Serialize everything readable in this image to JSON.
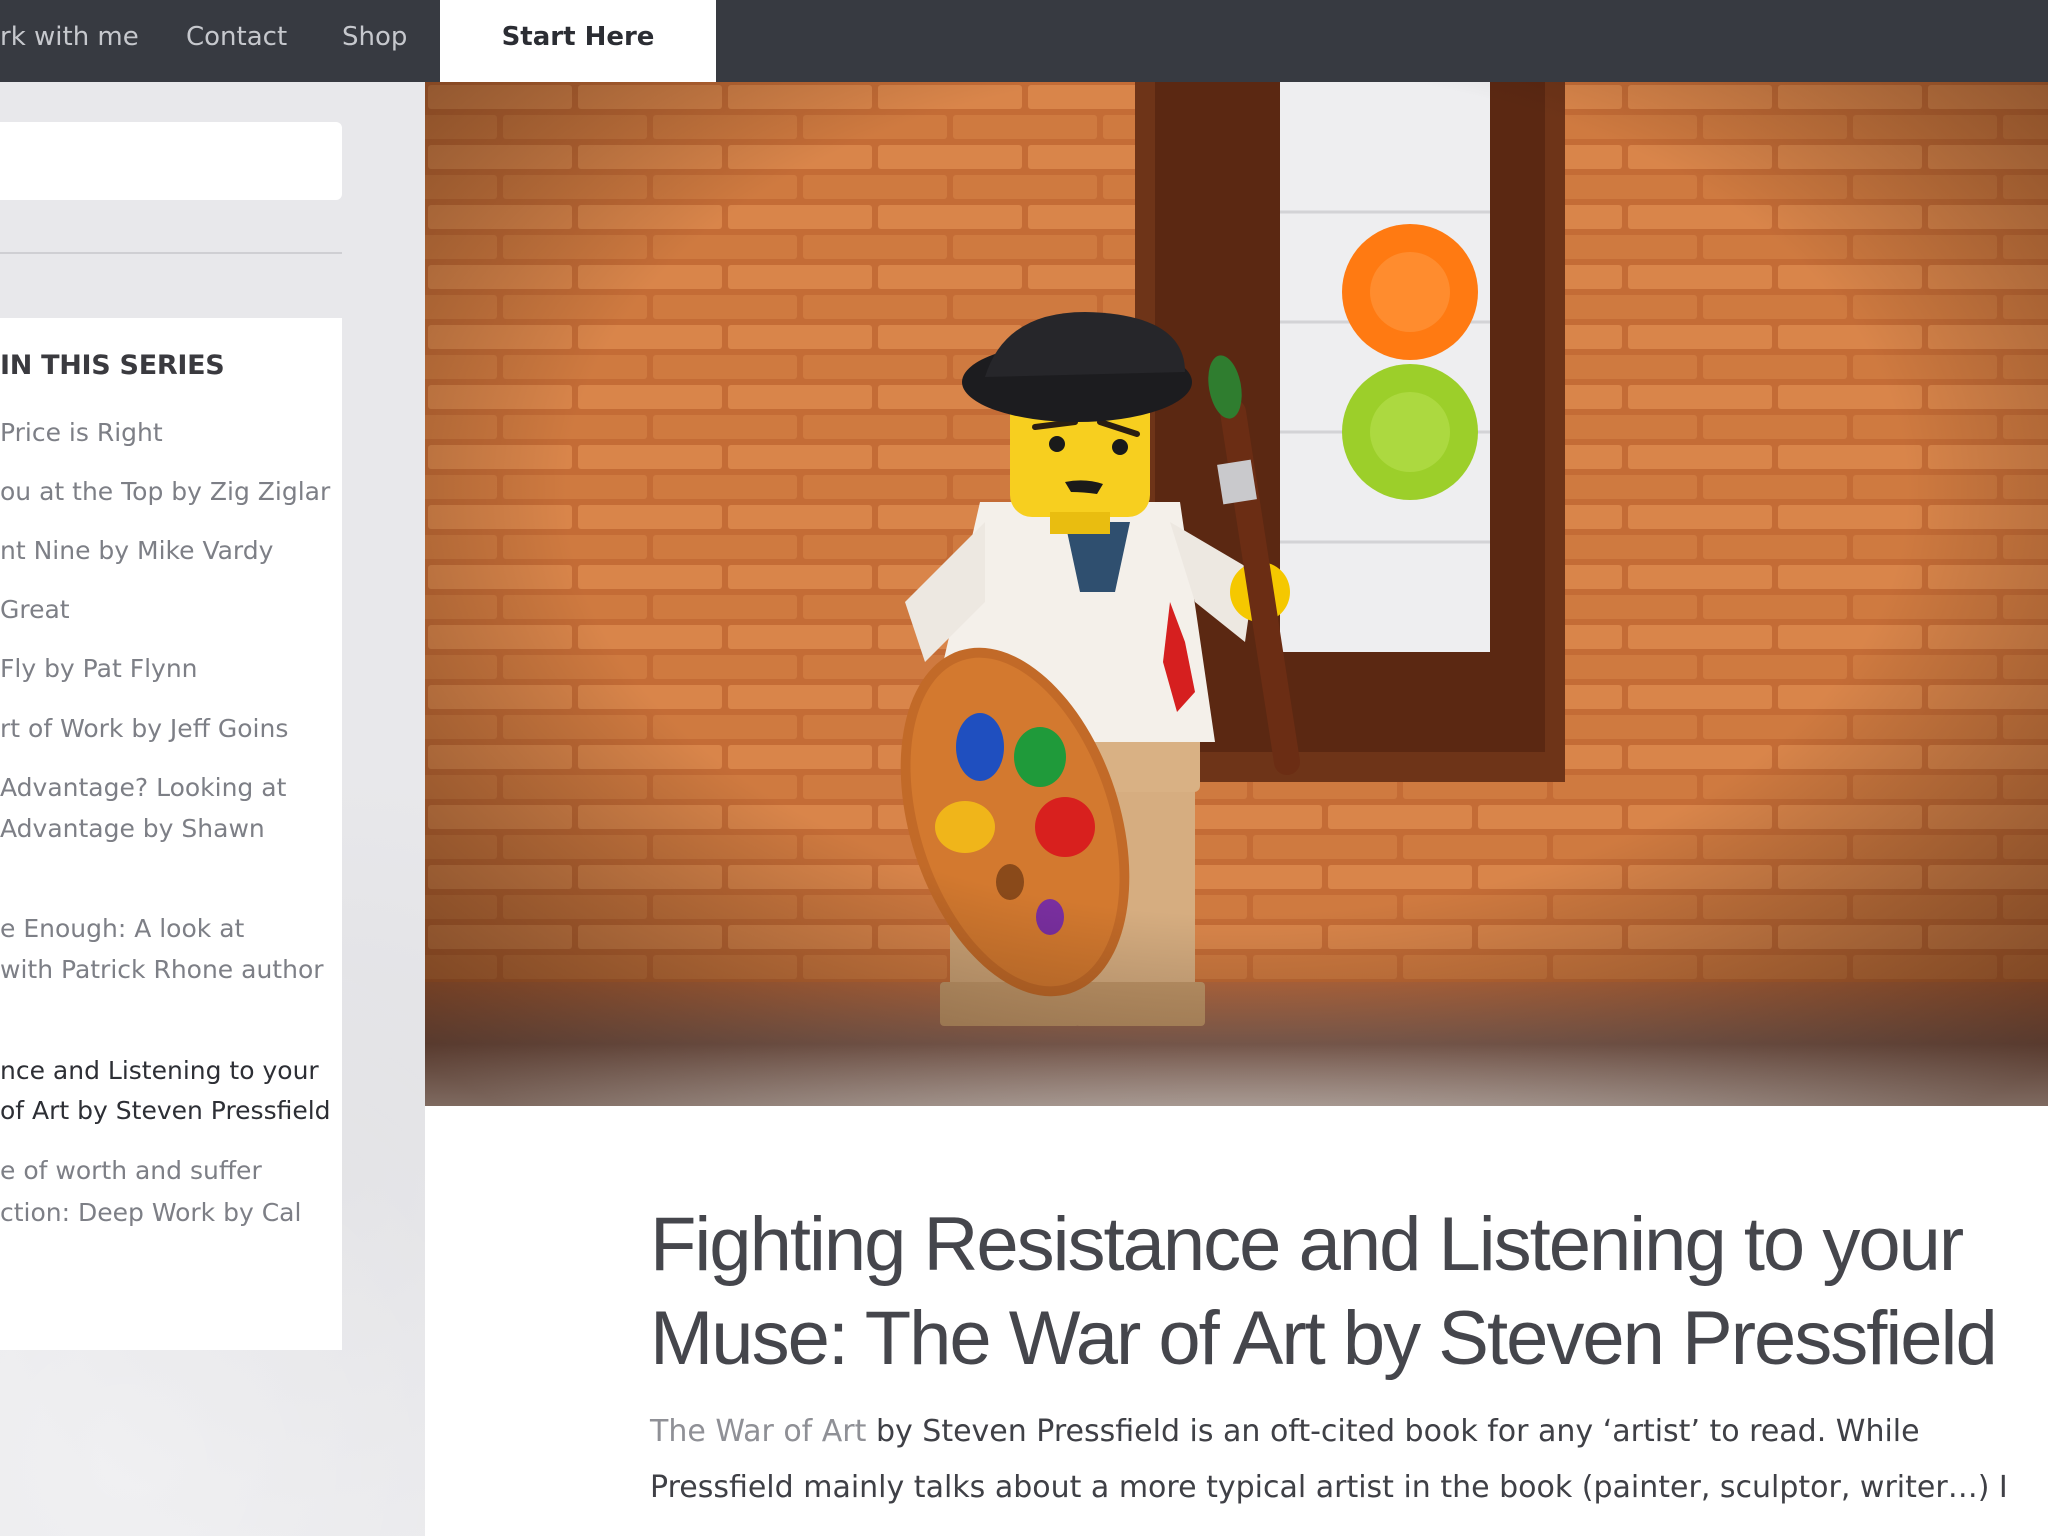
{
  "nav": {
    "items": [
      {
        "label": "rk with me"
      },
      {
        "label": "Contact"
      },
      {
        "label": "Shop"
      }
    ],
    "active": {
      "label": "Start Here"
    }
  },
  "sidebar": {
    "search": {
      "value": "",
      "placeholder": ""
    },
    "series": {
      "heading": "IN THIS SERIES",
      "lines": [
        "Price is Right",
        "ou at the Top by Zig Ziglar",
        "nt Nine by Mike Vardy",
        " Great",
        " Fly by Pat Flynn",
        "rt of Work by Jeff Goins",
        "Advantage? Looking at",
        "Advantage by Shawn",
        "e Enough: A look at",
        "with Patrick Rhone author",
        "nce and Listening to your",
        "of Art by Steven Pressfield",
        "e of worth and suffer",
        "ction: Deep Work by Cal"
      ]
    }
  },
  "hero": {
    "description": ""
  },
  "article": {
    "title_line1": "Fighting Resistance and Listening to your",
    "title_line2": "Muse: The War of Art by Steven Pressfield",
    "body_link": "The War of Art",
    "body_line1_rest": " by Steven Pressfield is an oft-cited book for any ‘artist’ to read. While",
    "body_line2": "Pressfield mainly talks about a more typical artist in the book (painter, sculptor, writer…) I"
  },
  "colors": {
    "topbar": "#373a41",
    "brick": "#c9733c",
    "link": "#8f9096"
  }
}
